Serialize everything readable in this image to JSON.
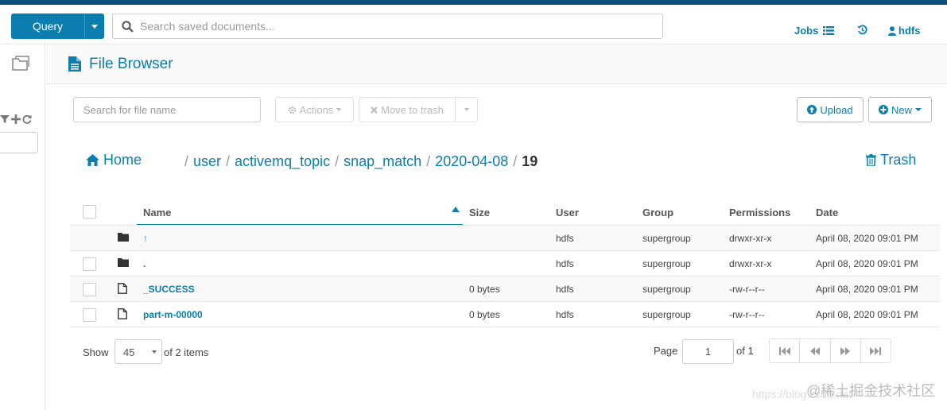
{
  "topbar": {
    "query_label": "Query",
    "search_placeholder": "Search saved documents...",
    "jobs_label": "Jobs",
    "user_label": "hdfs"
  },
  "page": {
    "title": "File Browser"
  },
  "toolbar": {
    "file_search_placeholder": "Search for file name",
    "actions_label": "Actions",
    "move_to_trash_label": "Move to trash",
    "upload_label": "Upload",
    "new_label": "New"
  },
  "breadcrumb": {
    "home_label": "Home",
    "segments": [
      "user",
      "activemq_topic",
      "snap_match",
      "2020-04-08"
    ],
    "current": "19",
    "trash_label": "Trash"
  },
  "table": {
    "headers": {
      "name": "Name",
      "size": "Size",
      "user": "User",
      "group": "Group",
      "permissions": "Permissions",
      "date": "Date"
    },
    "rows": [
      {
        "icon": "folder-icon",
        "name": "↑",
        "size": "",
        "user": "hdfs",
        "group": "supergroup",
        "permissions": "drwxr-xr-x",
        "date": "April 08, 2020 09:01 PM"
      },
      {
        "icon": "folder-icon",
        "name": ".",
        "size": "",
        "user": "hdfs",
        "group": "supergroup",
        "permissions": "drwxr-xr-x",
        "date": "April 08, 2020 09:01 PM"
      },
      {
        "icon": "file-icon",
        "name": "_SUCCESS",
        "size": "0 bytes",
        "user": "hdfs",
        "group": "supergroup",
        "permissions": "-rw-r--r--",
        "date": "April 08, 2020 09:01 PM"
      },
      {
        "icon": "file-icon",
        "name": "part-m-00000",
        "size": "0 bytes",
        "user": "hdfs",
        "group": "supergroup",
        "permissions": "-rw-r--r--",
        "date": "April 08, 2020 09:01 PM"
      }
    ]
  },
  "footer": {
    "show_label": "Show",
    "page_size": "45",
    "items_label": "of 2 items",
    "page_label": "Page",
    "page_value": "1",
    "of_pages": "of 1"
  },
  "watermark": {
    "text": "@稀土掘金技术社区",
    "url": "https://blog.csdn.net"
  },
  "colors": {
    "accent": "#0b7eaf",
    "topline": "#0b4f7c"
  }
}
